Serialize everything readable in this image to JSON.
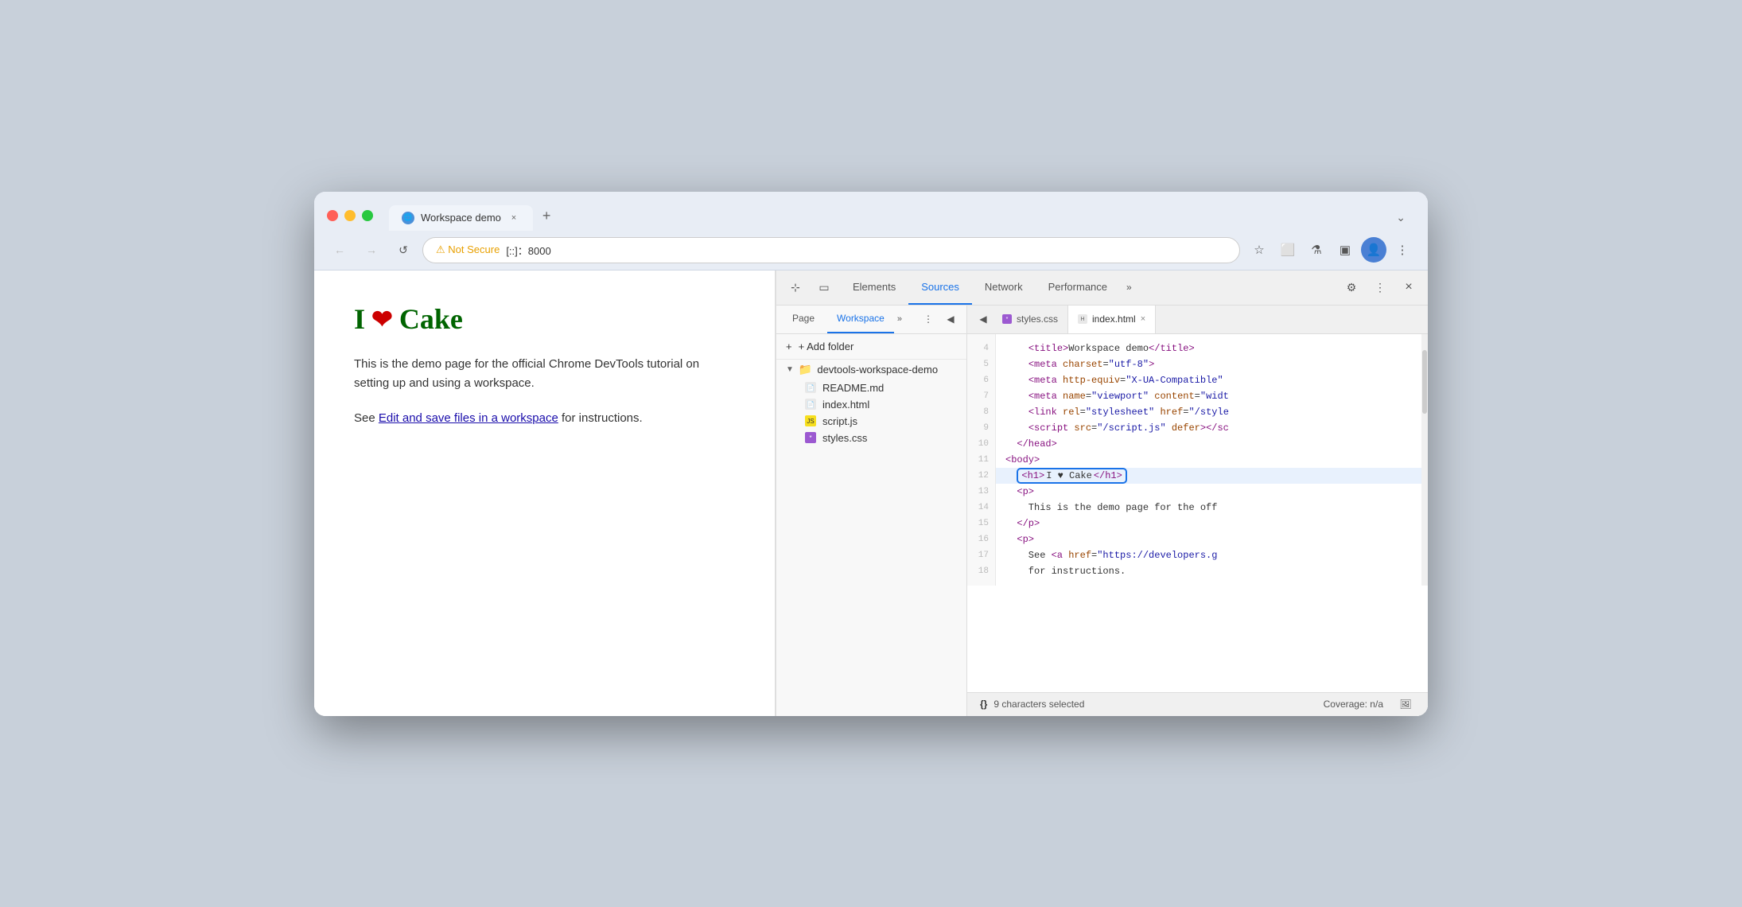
{
  "browser": {
    "tab_title": "Workspace demo",
    "tab_close": "×",
    "tab_new": "+",
    "tab_menu": "⌄",
    "address_warning": "⚠ Not Secure",
    "address_url": "[::]：8000",
    "nav": {
      "back": "←",
      "forward": "→",
      "refresh": "↺"
    },
    "nav_icons": {
      "star": "☆",
      "extensions": "⬜",
      "flask": "⚗",
      "sidebar": "▣",
      "profile": "👤",
      "menu": "⋮"
    }
  },
  "webpage": {
    "heading_green": "I",
    "heading_heart": "❤",
    "heading_cake": "Cake",
    "paragraph1": "This is the demo page for the official Chrome DevTools tutorial on setting up and using a workspace.",
    "paragraph2_prefix": "See ",
    "link_text": "Edit and save files in a workspace",
    "paragraph2_suffix": " for instructions."
  },
  "devtools": {
    "toolbar": {
      "tabs": [
        "Elements",
        "Sources",
        "Network",
        "Performance"
      ],
      "active_tab": "Sources",
      "more_label": "»",
      "settings_icon": "⚙",
      "more_icon": "⋮",
      "close_icon": "×",
      "cursor_icon": "⊹",
      "device_icon": "▭"
    },
    "sources": {
      "tabs": [
        "Page",
        "Workspace"
      ],
      "active_tab": "Workspace",
      "more_label": "»",
      "menu_icon": "⋮",
      "collapse_icon": "◀",
      "add_folder_label": "+ Add folder",
      "folder": {
        "name": "devtools-workspace-demo",
        "arrow": "▼",
        "files": [
          {
            "name": "README.md",
            "icon_type": "md"
          },
          {
            "name": "index.html",
            "icon_type": "html"
          },
          {
            "name": "script.js",
            "icon_type": "js"
          },
          {
            "name": "styles.css",
            "icon_type": "css"
          }
        ]
      }
    },
    "editor": {
      "tabs": [
        {
          "name": "styles.css",
          "icon_type": "css",
          "active": false
        },
        {
          "name": "index.html",
          "icon_type": "html",
          "active": true,
          "closable": true
        }
      ],
      "code_lines": [
        {
          "num": 4,
          "content": "    <title>Workspace demo<\\/title>"
        },
        {
          "num": 5,
          "content": "    <meta charset=\"utf-8\">"
        },
        {
          "num": 6,
          "content": "    <meta http-equiv=\"X-UA-Compatible\""
        },
        {
          "num": 7,
          "content": "    <meta name=\"viewport\" content=\"widt"
        },
        {
          "num": 8,
          "content": "    <link rel=\"stylesheet\" href=\"/style"
        },
        {
          "num": 9,
          "content": "    <script src=\"/script.js\" defer><\\/sc"
        },
        {
          "num": 10,
          "content": "  <\\/head>"
        },
        {
          "num": 11,
          "content": "<body>"
        },
        {
          "num": 12,
          "content": "  <h1>I ♥ Cake<\\/h1>",
          "highlighted": true
        },
        {
          "num": 13,
          "content": "  <p>"
        },
        {
          "num": 14,
          "content": "    This is the demo page for the off"
        },
        {
          "num": 15,
          "content": "  <\\/p>"
        },
        {
          "num": 16,
          "content": "  <p>"
        },
        {
          "num": 17,
          "content": "    See <a href=\"https://developers.g"
        },
        {
          "num": 18,
          "content": "    for instructions."
        }
      ]
    },
    "status_bar": {
      "braces": "{}",
      "selected_text": "9 characters selected",
      "coverage": "Coverage: n/a",
      "image_icon": "🖼"
    }
  }
}
